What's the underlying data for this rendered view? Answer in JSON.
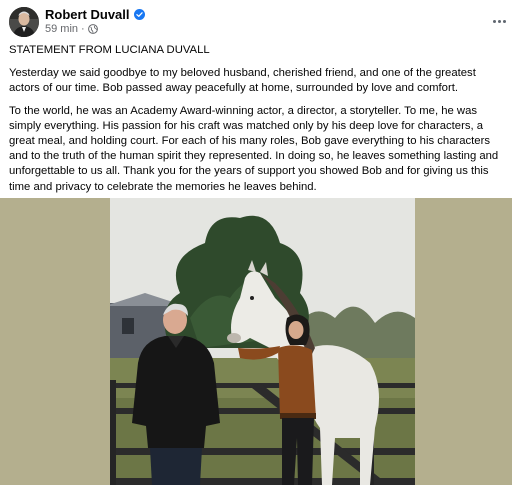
{
  "post": {
    "author": "Robert Duvall",
    "time": "59 min",
    "separator": "·",
    "headline": "STATEMENT FROM LUCIANA DUVALL",
    "paragraphs": [
      "Yesterday we said goodbye to my beloved husband, cherished friend, and one of the greatest actors of our time. Bob passed away peacefully at home, surrounded by love and comfort.",
      "To the world, he was an Academy Award-winning actor, a director, a storyteller. To me, he was simply everything. His passion for his craft was matched only by his deep love for characters, a great meal, and holding court. For each of his many roles, Bob gave everything to his characters and to the truth of the human spirit they represented. In doing so, he leaves something lasting and unforgettable to us all. Thank you for the years of support you showed Bob and for giving us this time and privacy to celebrate the memories he leaves behind."
    ]
  },
  "icons": {
    "verified": "verified-badge-icon",
    "audience": "globe-icon",
    "more": "more-options-icon"
  },
  "colors": {
    "verified_blue": "#1877f2",
    "meta_gray": "#65676b",
    "photo_backdrop": "#b4af8e"
  }
}
